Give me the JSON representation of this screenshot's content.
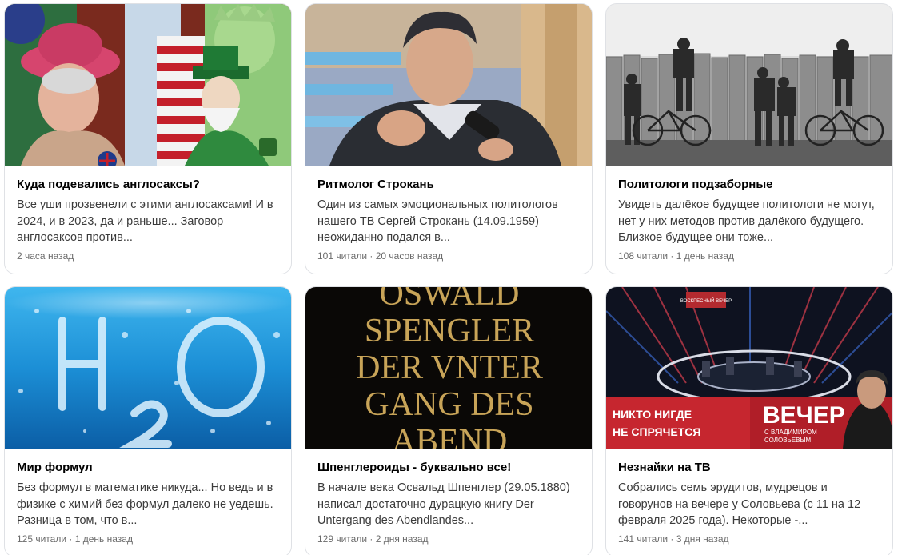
{
  "feed": {
    "cards": [
      {
        "title": "Куда подевались англосаксы?",
        "snippet": "Все уши прозвенели с этими англосаксами! И в 2024, и в 2023, да и раньше... Заговор англосаксов против...",
        "meta": "2 часа назад",
        "image": "queen-uncle-sam-liberty-caricature"
      },
      {
        "title": "Ритмолог Строкань",
        "snippet": "Один из самых эмоциональных политологов нашего ТВ Сергей Строкань (14.09.1959) неожиданно подался в...",
        "meta": "101 читали · 20 часов назад",
        "image": "man-speaking-microphone-tv-studio"
      },
      {
        "title": "Политологи подзаборные",
        "snippet": "Увидеть далёкое будущее политологи не могут, нет у них методов против далёкого будущего. Близкое будущее они тоже...",
        "meta": "108 читали · 1 день назад",
        "image": "men-peeking-over-wooden-fence-bw"
      },
      {
        "title": "Мир формул",
        "snippet": "Без формул в математике никуда... Но ведь и в физике с химий без формул далеко не уедешь. Разница в том, что в...",
        "meta": "125 читали · 1 день назад",
        "image": "h2o-letters-underwater-bubbles"
      },
      {
        "title": "Шпенглероиды - буквально все!",
        "snippet": "В начале века Освальд Шпенглер (29.05.1880) написал достаточно дурацкую книгу Der Untergang des Abendlandes...",
        "meta": "129 читали · 2 дня назад",
        "image": "book-cover-gold-letters",
        "cover_lines": [
          "OSWALD",
          "SPENGLER",
          "DER VNTER",
          "GANG DES",
          "ABEND"
        ]
      },
      {
        "title": "Незнайки на ТВ",
        "snippet": "Собрались семь эрудитов, мудрецов и говорунов на вечере у Соловьева (с 11 на 12 февраля 2025 года). Некоторые -...",
        "meta": "141 читали · 3 дня назад",
        "image": "tv-show-studio-banner",
        "banner": {
          "small": "ВОСКРЕСНЫЙ ВЕЧЕР",
          "left_line1": "НИКТО НИГДЕ",
          "left_line2": "НЕ СПРЯЧЕТСЯ",
          "big": "ВЕЧЕР",
          "sub1": "С ВЛАДИМИРОМ",
          "sub2": "СОЛОВЬЕВЫМ"
        }
      }
    ]
  }
}
